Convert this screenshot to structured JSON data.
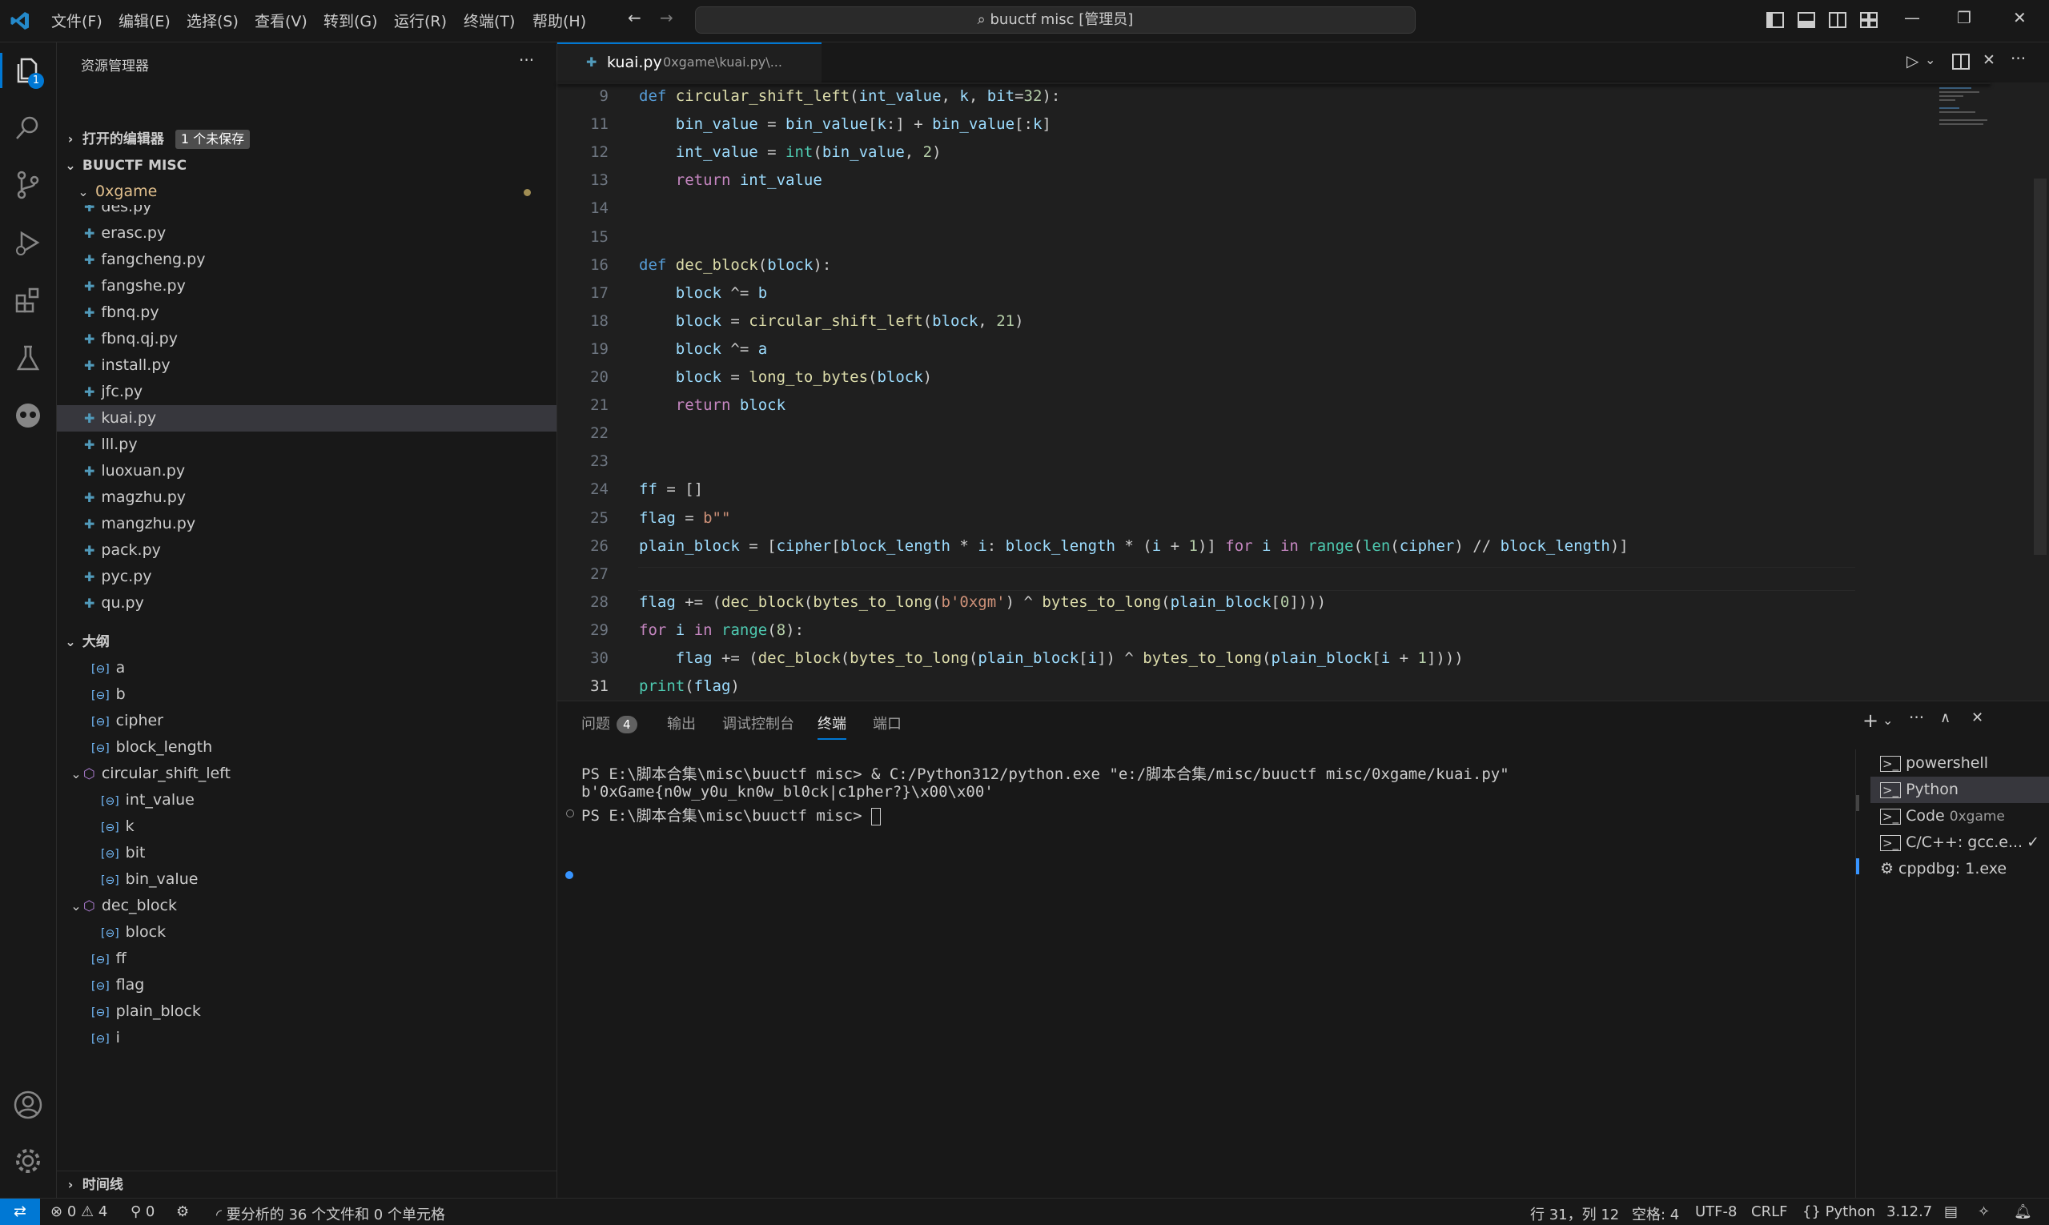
{
  "titlebar": {
    "menus": [
      "文件(F)",
      "编辑(E)",
      "选择(S)",
      "查看(V)",
      "转到(G)",
      "运行(R)",
      "终端(T)",
      "帮助(H)"
    ],
    "search_text": "buuctf misc [管理员]"
  },
  "activity_badge": "1",
  "explorer": {
    "title": "资源管理器",
    "open_editors": "打开的编辑器",
    "unsaved_badge": "1 个未保存",
    "workspace": "BUUCTF MISC",
    "folder": "0xgame",
    "partial_top": "des.py",
    "files": [
      "erasc.py",
      "fangcheng.py",
      "fangshe.py",
      "fbnq.py",
      "fbnq.qj.py",
      "install.py",
      "jfc.py",
      "kuai.py",
      "lll.py",
      "luoxuan.py",
      "magzhu.py",
      "mangzhu.py",
      "pack.py",
      "pyc.py",
      "qu.py"
    ],
    "selected_file": "kuai.py"
  },
  "outline": {
    "title": "大纲",
    "items": [
      {
        "label": "a",
        "kind": "var",
        "level": 0
      },
      {
        "label": "b",
        "kind": "var",
        "level": 0
      },
      {
        "label": "cipher",
        "kind": "var",
        "level": 0
      },
      {
        "label": "block_length",
        "kind": "var",
        "level": 0
      },
      {
        "label": "circular_shift_left",
        "kind": "fn",
        "level": 0
      },
      {
        "label": "int_value",
        "kind": "var",
        "level": 1
      },
      {
        "label": "k",
        "kind": "var",
        "level": 1
      },
      {
        "label": "bit",
        "kind": "var",
        "level": 1
      },
      {
        "label": "bin_value",
        "kind": "var",
        "level": 1
      },
      {
        "label": "dec_block",
        "kind": "fn",
        "level": 0
      },
      {
        "label": "block",
        "kind": "var",
        "level": 1
      },
      {
        "label": "ff",
        "kind": "var",
        "level": 0
      },
      {
        "label": "flag",
        "kind": "var",
        "level": 0
      },
      {
        "label": "plain_block",
        "kind": "var",
        "level": 0
      },
      {
        "label": "i",
        "kind": "var",
        "level": 0
      }
    ]
  },
  "timeline": "时间线",
  "tab": {
    "name": "kuai.py",
    "path": "0xgame\\kuai.py\\..."
  },
  "code_lines": [
    {
      "n": "9",
      "text": "def circular_shift_left(int_value, k, bit=32):"
    },
    {
      "n": "11",
      "text": "    bin_value = bin_value[k:] + bin_value[:k]"
    },
    {
      "n": "12",
      "text": "    int_value = int(bin_value, 2)"
    },
    {
      "n": "13",
      "text": "    return int_value"
    },
    {
      "n": "14",
      "text": ""
    },
    {
      "n": "15",
      "text": ""
    },
    {
      "n": "16",
      "text": "def dec_block(block):"
    },
    {
      "n": "17",
      "text": "    block ^= b"
    },
    {
      "n": "18",
      "text": "    block = circular_shift_left(block, 21)"
    },
    {
      "n": "19",
      "text": "    block ^= a"
    },
    {
      "n": "20",
      "text": "    block = long_to_bytes(block)"
    },
    {
      "n": "21",
      "text": "    return block"
    },
    {
      "n": "22",
      "text": ""
    },
    {
      "n": "23",
      "text": ""
    },
    {
      "n": "24",
      "text": "ff = []"
    },
    {
      "n": "25",
      "text": "flag = b\"\""
    },
    {
      "n": "26",
      "text": "plain_block = [cipher[block_length * i: block_length * (i + 1)] for i in range(len(cipher) // block_length)]"
    },
    {
      "n": "27",
      "text": ""
    },
    {
      "n": "28",
      "text": "flag += (dec_block(bytes_to_long(b'0xgm') ^ bytes_to_long(plain_block[0])))"
    },
    {
      "n": "29",
      "text": "for i in range(8):"
    },
    {
      "n": "30",
      "text": "    flag += (dec_block(bytes_to_long(plain_block[i]) ^ bytes_to_long(plain_block[i + 1])))"
    },
    {
      "n": "31",
      "text": "print(flag)"
    }
  ],
  "panel": {
    "tabs": [
      "问题",
      "输出",
      "调试控制台",
      "终端",
      "端口"
    ],
    "problems_count": "4",
    "active_tab": "终端",
    "terminal_lines": [
      "PS E:\\脚本合集\\misc\\buuctf misc> & C:/Python312/python.exe \"e:/脚本合集/misc/buuctf misc/0xgame/kuai.py\"",
      "b'0xGame{n0w_y0u_kn0w_bl0ck|c1pher?}\\x00\\x00'",
      "PS E:\\脚本合集\\misc\\buuctf misc> "
    ],
    "terminals": [
      {
        "name": "powershell",
        "detail": ""
      },
      {
        "name": "Python",
        "detail": ""
      },
      {
        "name": "Code",
        "detail": "0xgame"
      },
      {
        "name": "C/C++: gcc.e...",
        "detail": ""
      },
      {
        "name": "cppdbg: 1.exe",
        "detail": ""
      }
    ]
  },
  "statusbar": {
    "errors": "0",
    "warnings": "4",
    "ports": "0",
    "analysis": "要分析的 36 个文件和 0 个单元格",
    "position": "行 31，列 12",
    "spaces": "空格: 4",
    "encoding": "UTF-8",
    "eol": "CRLF",
    "language": "Python",
    "version": "3.12.7"
  },
  "colors": {
    "accent": "#0078d4",
    "keyword": "#569cd6",
    "function": "#dcdcaa",
    "string": "#ce9178",
    "number": "#b5cea8"
  }
}
